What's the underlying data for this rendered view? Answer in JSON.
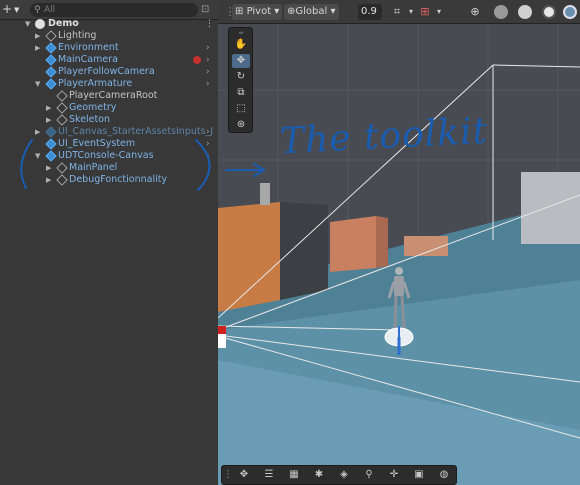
{
  "hierarchy": {
    "add_label": "+",
    "search_placeholder": "All",
    "scene_name": "Demo",
    "items": [
      {
        "label": "Lighting",
        "color": "#c4c4c4"
      },
      {
        "label": "Environment",
        "color": "#7fb3e6"
      },
      {
        "label": "MainCamera",
        "color": "#7fb3e6"
      },
      {
        "label": "PlayerFollowCamera",
        "color": "#7fb3e6"
      },
      {
        "label": "PlayerArmature",
        "color": "#7fb3e6"
      },
      {
        "label": "PlayerCameraRoot",
        "color": "#c4c4c4"
      },
      {
        "label": "Geometry",
        "color": "#7fb3e6"
      },
      {
        "label": "Skeleton",
        "color": "#7fb3e6"
      },
      {
        "label": "UI_Canvas_StarterAssetsInputs_J",
        "color": "#5f84a8"
      },
      {
        "label": "UI_EventSystem",
        "color": "#7fb3e6"
      },
      {
        "label": "UDTConsole-Canvas",
        "color": "#7fb3e6"
      },
      {
        "label": "MainPanel",
        "color": "#7fb3e6"
      },
      {
        "label": "DebugFonctionnality",
        "color": "#7fb3e6"
      }
    ]
  },
  "annotation": {
    "text": "The toolkit",
    "color": "#1a5cb0"
  },
  "scene_toolbar": {
    "pivot_label": "Pivot",
    "global_label": "Global",
    "snap_value": "0.9"
  },
  "icons": {
    "tools": [
      "hand-tool-icon",
      "move-tool-icon",
      "rotate-tool-icon",
      "scale-tool-icon",
      "rect-tool-icon",
      "transform-tool-icon"
    ],
    "bottom": [
      "move-icon",
      "sliders-icon",
      "grid-icon",
      "bug-icon",
      "eye-icon",
      "zoom-icon",
      "move-cross-icon",
      "camera-icon",
      "compass-icon"
    ]
  }
}
